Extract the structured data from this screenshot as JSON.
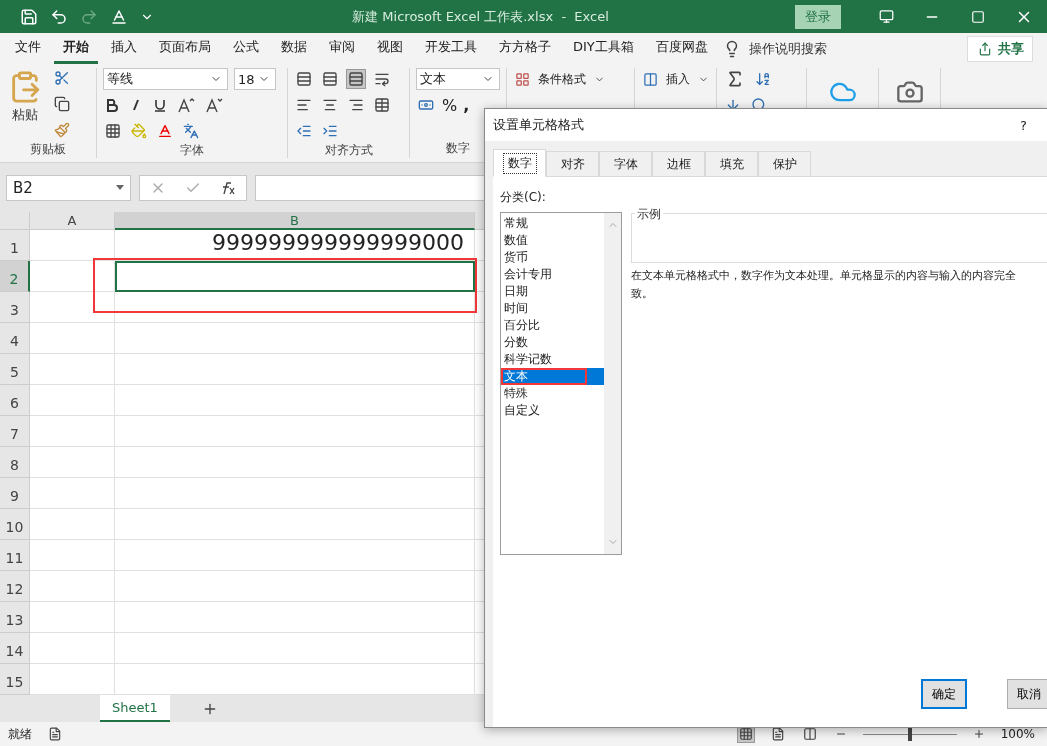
{
  "window": {
    "title": "新建 Microsoft Excel 工作表.xlsx  -  Excel",
    "login": "登录"
  },
  "menu": {
    "tabs": [
      {
        "label": "文件",
        "selected": false
      },
      {
        "label": "开始",
        "selected": true
      },
      {
        "label": "插入",
        "selected": false
      },
      {
        "label": "页面布局",
        "selected": false
      },
      {
        "label": "公式",
        "selected": false
      },
      {
        "label": "数据",
        "selected": false
      },
      {
        "label": "审阅",
        "selected": false
      },
      {
        "label": "视图",
        "selected": false
      },
      {
        "label": "开发工具",
        "selected": false
      },
      {
        "label": "方方格子",
        "selected": false
      },
      {
        "label": "DIY工具箱",
        "selected": false
      },
      {
        "label": "百度网盘",
        "selected": false
      }
    ],
    "search": "操作说明搜索",
    "share": "共享"
  },
  "ribbon": {
    "groups": [
      {
        "kind": "clipboard",
        "label": "剪贴板",
        "paste": "粘贴"
      },
      {
        "kind": "font",
        "label": "字体",
        "font_name": "等线",
        "font_size": "18"
      },
      {
        "kind": "alignment",
        "label": "对齐方式",
        "vertical": [
          {
            "selected": false
          },
          {
            "selected": false
          },
          {
            "selected": true
          }
        ]
      },
      {
        "kind": "number",
        "label": "数字",
        "format": "文本",
        "percent": "%",
        "comma": ","
      },
      {
        "kind": "styles",
        "items": [
          "条件格式"
        ]
      },
      {
        "kind": "cells",
        "items": [
          "插入"
        ]
      },
      {
        "kind": "editing"
      },
      {
        "kind": "cloud"
      },
      {
        "kind": "camera"
      }
    ]
  },
  "formula_bar": {
    "name_box": "B2"
  },
  "sheet": {
    "columns": [
      {
        "label": "A",
        "selected": false
      },
      {
        "label": "B",
        "selected": true
      }
    ],
    "rows": [
      {
        "number": "1",
        "cells": [
          "",
          "999999999999999000"
        ],
        "selected": false
      },
      {
        "number": "2",
        "cells": [
          "",
          ""
        ],
        "selected": true
      },
      {
        "number": "3",
        "cells": [
          "",
          ""
        ],
        "selected": false
      },
      {
        "number": "4",
        "cells": [
          "",
          ""
        ],
        "selected": false
      },
      {
        "number": "5",
        "cells": [
          "",
          ""
        ],
        "selected": false
      },
      {
        "number": "6",
        "cells": [
          "",
          ""
        ],
        "selected": false
      },
      {
        "number": "7",
        "cells": [
          "",
          ""
        ],
        "selected": false
      },
      {
        "number": "8",
        "cells": [
          "",
          ""
        ],
        "selected": false
      },
      {
        "number": "9",
        "cells": [
          "",
          ""
        ],
        "selected": false
      },
      {
        "number": "10",
        "cells": [
          "",
          ""
        ],
        "selected": false
      },
      {
        "number": "11",
        "cells": [
          "",
          ""
        ],
        "selected": false
      },
      {
        "number": "12",
        "cells": [
          "",
          ""
        ],
        "selected": false
      },
      {
        "number": "13",
        "cells": [
          "",
          ""
        ],
        "selected": false
      },
      {
        "number": "14",
        "cells": [
          "",
          ""
        ],
        "selected": false
      },
      {
        "number": "15",
        "cells": [
          "",
          ""
        ],
        "selected": false
      }
    ]
  },
  "sheet_tabs": [
    {
      "label": "Sheet1",
      "selected": true
    }
  ],
  "status_bar": {
    "status": "就绪",
    "zoom": {
      "level": 0.5,
      "reading": "100%"
    }
  },
  "dialog": {
    "title": "设置单元格格式",
    "help": "?",
    "tabs": [
      {
        "label": "数字",
        "selected": true
      },
      {
        "label": "对齐",
        "selected": false
      },
      {
        "label": "字体",
        "selected": false
      },
      {
        "label": "边框",
        "selected": false
      },
      {
        "label": "填充",
        "selected": false
      },
      {
        "label": "保护",
        "selected": false
      }
    ],
    "category_label": "分类(C):",
    "categories": [
      {
        "label": "常规",
        "selected": false
      },
      {
        "label": "数值",
        "selected": false
      },
      {
        "label": "货币",
        "selected": false
      },
      {
        "label": "会计专用",
        "selected": false
      },
      {
        "label": "日期",
        "selected": false
      },
      {
        "label": "时间",
        "selected": false
      },
      {
        "label": "百分比",
        "selected": false
      },
      {
        "label": "分数",
        "selected": false
      },
      {
        "label": "科学记数",
        "selected": false
      },
      {
        "label": "文本",
        "selected": true
      },
      {
        "label": "特殊",
        "selected": false
      },
      {
        "label": "自定义",
        "selected": false
      }
    ],
    "sample_label": "示例",
    "description": [
      "在文本单元格格式中，数字作为文本处理。单元格显示的内容与输入的内容完全",
      "致。"
    ],
    "buttons": [
      "确定",
      "取消"
    ]
  }
}
